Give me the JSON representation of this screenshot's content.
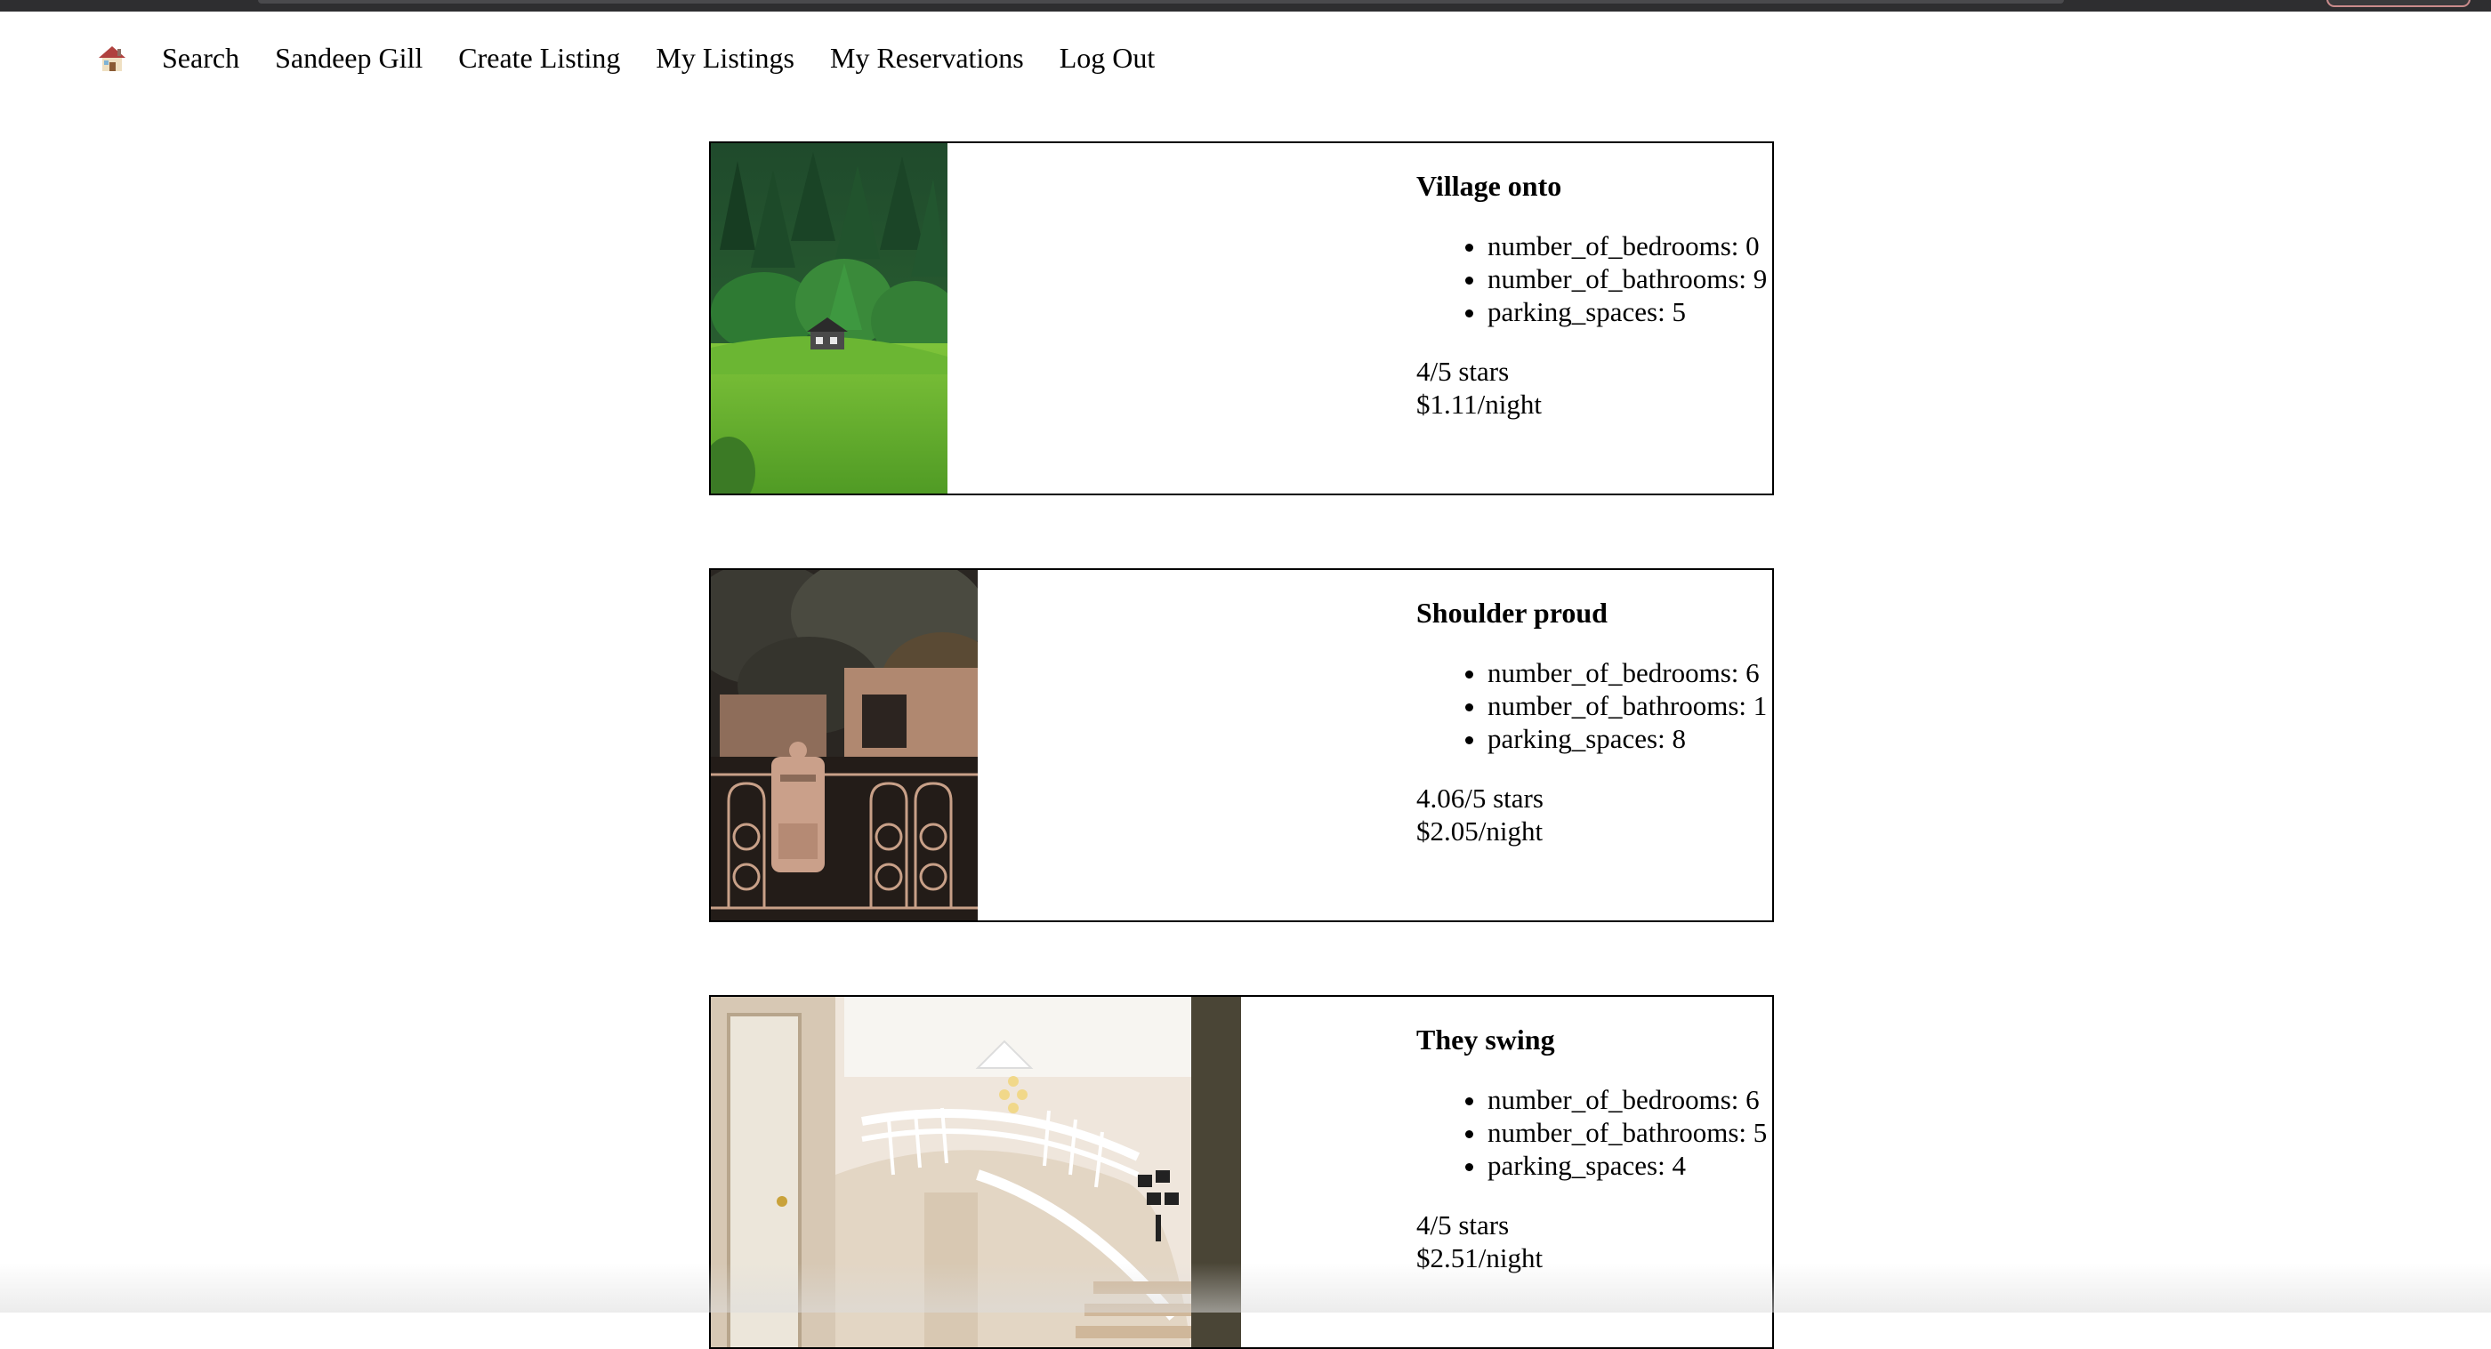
{
  "nav": {
    "home_icon": "house-emoji-icon",
    "items": [
      {
        "label": "Search"
      },
      {
        "label": "Sandeep Gill"
      },
      {
        "label": "Create Listing"
      },
      {
        "label": "My Listings"
      },
      {
        "label": "My Reservations"
      },
      {
        "label": "Log Out"
      }
    ]
  },
  "listings": [
    {
      "title": "Village onto",
      "image": "forest-hillside-cabin-photo",
      "features": [
        "number_of_bedrooms: 0",
        "number_of_bathrooms: 9",
        "parking_spaces: 5"
      ],
      "rating": "4/5 stars",
      "price": "$1.11/night"
    },
    {
      "title": "Shoulder proud",
      "image": "ornate-iron-gate-mailbox-photo",
      "features": [
        "number_of_bedrooms: 6",
        "number_of_bathrooms: 1",
        "parking_spaces: 8"
      ],
      "rating": "4.06/5 stars",
      "price": "$2.05/night"
    },
    {
      "title": "They swing",
      "image": "curved-staircase-chandelier-photo",
      "features": [
        "number_of_bedrooms: 6",
        "number_of_bathrooms: 5",
        "parking_spaces: 4"
      ],
      "rating": "4/5 stars",
      "price": "$2.51/night"
    }
  ]
}
